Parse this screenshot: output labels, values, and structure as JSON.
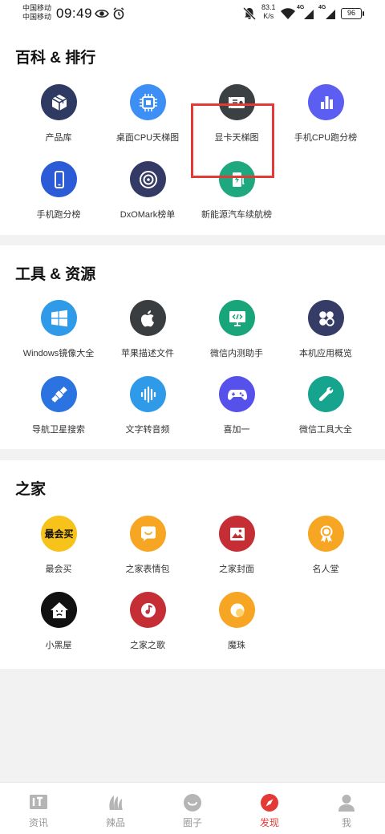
{
  "status_bar": {
    "carrier_1": "中国移动",
    "carrier_2": "中国移动",
    "time": "09:49",
    "speed_value": "83.1",
    "speed_unit": "K/s",
    "signal_1": "4G",
    "signal_2": "4G",
    "battery": "96"
  },
  "sections": [
    {
      "title": "百科 & 排行",
      "items": [
        {
          "label": "产品库",
          "icon": "cube-icon",
          "color": "#2f3a63"
        },
        {
          "label": "桌面CPU天梯图",
          "icon": "cpu-chip-icon",
          "color": "#3d8ff5"
        },
        {
          "label": "显卡天梯图",
          "icon": "graphics-card-icon",
          "color": "#3b4043"
        },
        {
          "label": "手机CPU跑分榜",
          "icon": "bar-chart-icon",
          "color": "#5b5ef0"
        },
        {
          "label": "手机跑分榜",
          "icon": "smartphone-icon",
          "color": "#2b5bd6"
        },
        {
          "label": "DxOMark榜单",
          "icon": "camera-lens-icon",
          "color": "#343a66"
        },
        {
          "label": "新能源汽车续航榜",
          "icon": "charging-station-icon",
          "color": "#1fa87f"
        }
      ]
    },
    {
      "title": "工具 & 资源",
      "items": [
        {
          "label": "Windows镜像大全",
          "icon": "windows-logo-icon",
          "color": "#2f9be8"
        },
        {
          "label": "苹果描述文件",
          "icon": "apple-logo-icon",
          "color": "#3a3d40"
        },
        {
          "label": "微信内测助手",
          "icon": "code-screen-icon",
          "color": "#18a579"
        },
        {
          "label": "本机应用概览",
          "icon": "app-grid-icon",
          "color": "#353d66"
        },
        {
          "label": "导航卫星搜索",
          "icon": "satellite-icon",
          "color": "#2b73e0"
        },
        {
          "label": "文字转音频",
          "icon": "sound-wave-icon",
          "color": "#2f9be8"
        },
        {
          "label": "喜加一",
          "icon": "gamepad-icon",
          "color": "#5551ea"
        },
        {
          "label": "微信工具大全",
          "icon": "wrench-icon",
          "color": "#16a48f"
        }
      ]
    },
    {
      "title": "之家",
      "items": [
        {
          "label": "最会买",
          "icon": "zuihuimai-logo-icon",
          "icon_text": "最会买",
          "color": "#f7c31b"
        },
        {
          "label": "之家表情包",
          "icon": "smile-bubble-icon",
          "color": "#f6a623"
        },
        {
          "label": "之家封面",
          "icon": "picture-icon",
          "color": "#c62e36"
        },
        {
          "label": "名人堂",
          "icon": "medal-icon",
          "color": "#f6a623"
        },
        {
          "label": "小黑屋",
          "icon": "sad-house-icon",
          "color": "#111111"
        },
        {
          "label": "之家之歌",
          "icon": "music-disc-icon",
          "color": "#c62e36"
        },
        {
          "label": "魔珠",
          "icon": "magic-orb-icon",
          "color": "#f6a623"
        }
      ]
    }
  ],
  "bottom_nav": [
    {
      "label": "资讯",
      "icon": "it-news-icon",
      "active": false
    },
    {
      "label": "辣品",
      "icon": "chili-icon",
      "active": false
    },
    {
      "label": "圈子",
      "icon": "smile-circle-icon",
      "active": false
    },
    {
      "label": "发现",
      "icon": "compass-icon",
      "active": true
    },
    {
      "label": "我",
      "icon": "person-icon",
      "active": false
    }
  ],
  "colors": {
    "accent": "#e53935",
    "nav_inactive": "#999999"
  }
}
